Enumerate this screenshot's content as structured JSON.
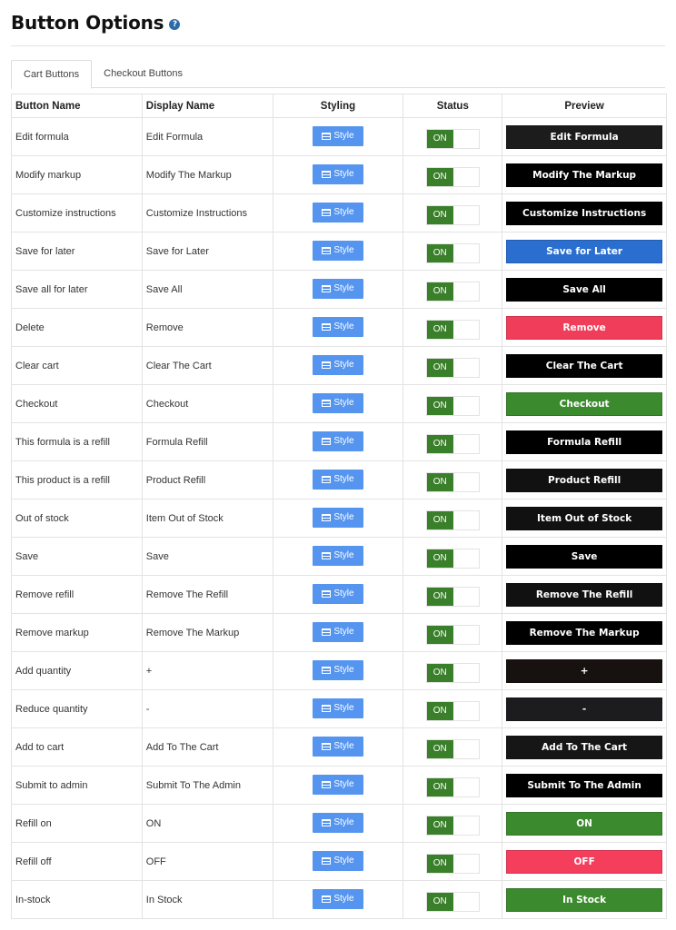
{
  "header": {
    "title": "Button Options",
    "help_icon": "question-circle-icon"
  },
  "tabs": [
    {
      "label": "Cart Buttons",
      "active": true
    },
    {
      "label": "Checkout Buttons",
      "active": false
    }
  ],
  "table": {
    "columns": [
      "Button Name",
      "Display Name",
      "Styling",
      "Status",
      "Preview"
    ],
    "style_button_label": "Style",
    "style_button_icon": "list-icon",
    "rows": [
      {
        "button_name": "Edit formula",
        "display_name": "Edit Formula",
        "status": "ON",
        "preview_label": "Edit Formula",
        "preview_color": "#1c1c1c"
      },
      {
        "button_name": "Modify markup",
        "display_name": "Modify The Markup",
        "status": "ON",
        "preview_label": "Modify The Markup",
        "preview_color": "#000000"
      },
      {
        "button_name": "Customize instructions",
        "display_name": "Customize Instructions",
        "status": "ON",
        "preview_label": "Customize Instructions",
        "preview_color": "#000000"
      },
      {
        "button_name": "Save for later",
        "display_name": "Save for Later",
        "status": "ON",
        "preview_label": "Save for Later",
        "preview_color": "#2a6fd0"
      },
      {
        "button_name": "Save all for later",
        "display_name": "Save All",
        "status": "ON",
        "preview_label": "Save All",
        "preview_color": "#000000"
      },
      {
        "button_name": "Delete",
        "display_name": "Remove",
        "status": "ON",
        "preview_label": "Remove",
        "preview_color": "#f03e5a"
      },
      {
        "button_name": "Clear cart",
        "display_name": "Clear The Cart",
        "status": "ON",
        "preview_label": "Clear The Cart",
        "preview_color": "#000000"
      },
      {
        "button_name": "Checkout",
        "display_name": "Checkout",
        "status": "ON",
        "preview_label": "Checkout",
        "preview_color": "#3c8a2e"
      },
      {
        "button_name": "This formula is a refill",
        "display_name": "Formula Refill",
        "status": "ON",
        "preview_label": "Formula Refill",
        "preview_color": "#000000"
      },
      {
        "button_name": "This product is a refill",
        "display_name": "Product Refill",
        "status": "ON",
        "preview_label": "Product Refill",
        "preview_color": "#111111"
      },
      {
        "button_name": "Out of stock",
        "display_name": "Item Out of Stock",
        "status": "ON",
        "preview_label": "Item Out of Stock",
        "preview_color": "#111111"
      },
      {
        "button_name": "Save",
        "display_name": "Save",
        "status": "ON",
        "preview_label": "Save",
        "preview_color": "#000000"
      },
      {
        "button_name": "Remove refill",
        "display_name": "Remove The Refill",
        "status": "ON",
        "preview_label": "Remove The Refill",
        "preview_color": "#111111"
      },
      {
        "button_name": "Remove markup",
        "display_name": "Remove The Markup",
        "status": "ON",
        "preview_label": "Remove The Markup",
        "preview_color": "#000000"
      },
      {
        "button_name": "Add quantity",
        "display_name": "+",
        "status": "ON",
        "preview_label": "+",
        "preview_color": "#17120f"
      },
      {
        "button_name": "Reduce quantity",
        "display_name": "-",
        "status": "ON",
        "preview_label": "-",
        "preview_color": "#1c1c1e"
      },
      {
        "button_name": "Add to cart",
        "display_name": "Add To The Cart",
        "status": "ON",
        "preview_label": "Add To The Cart",
        "preview_color": "#161616"
      },
      {
        "button_name": "Submit to admin",
        "display_name": "Submit To The Admin",
        "status": "ON",
        "preview_label": "Submit To The Admin",
        "preview_color": "#000000"
      },
      {
        "button_name": "Refill on",
        "display_name": "ON",
        "status": "ON",
        "preview_label": "ON",
        "preview_color": "#3c8a2e"
      },
      {
        "button_name": "Refill off",
        "display_name": "OFF",
        "status": "ON",
        "preview_label": "OFF",
        "preview_color": "#f43e5c"
      },
      {
        "button_name": "In-stock",
        "display_name": "In Stock",
        "status": "ON",
        "preview_label": "In Stock",
        "preview_color": "#3c8a2e"
      }
    ]
  }
}
